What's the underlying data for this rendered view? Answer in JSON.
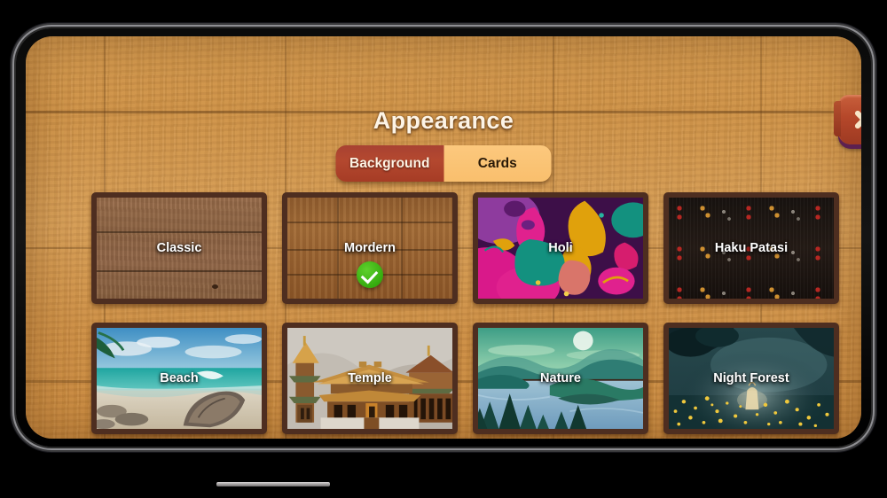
{
  "window": {
    "title": "Appearance",
    "close_label": "×"
  },
  "tabs": [
    {
      "id": "background",
      "label": "Background",
      "active": true
    },
    {
      "id": "cards",
      "label": "Cards",
      "active": false
    }
  ],
  "themes": [
    {
      "id": "classic",
      "label": "Classic",
      "selected": false
    },
    {
      "id": "mordern",
      "label": "Mordern",
      "selected": true
    },
    {
      "id": "holi",
      "label": "Holi",
      "selected": false
    },
    {
      "id": "haku-patasi",
      "label": "Haku Patasi",
      "selected": false
    },
    {
      "id": "beach",
      "label": "Beach",
      "selected": false
    },
    {
      "id": "temple",
      "label": "Temple",
      "selected": false
    },
    {
      "id": "nature",
      "label": "Nature",
      "selected": false
    },
    {
      "id": "night-forest",
      "label": "Night Forest",
      "selected": false
    }
  ],
  "colors": {
    "board_wood": "#d49a4e",
    "title_text": "#fdf4e6",
    "tab_active_bg": "#a84232",
    "tab_inactive_bg": "#fcc87d",
    "close_button": "#b5472a",
    "selected_badge": "#35ab0e",
    "card_border": "#4e2e20"
  },
  "selected_theme": "Mordern"
}
